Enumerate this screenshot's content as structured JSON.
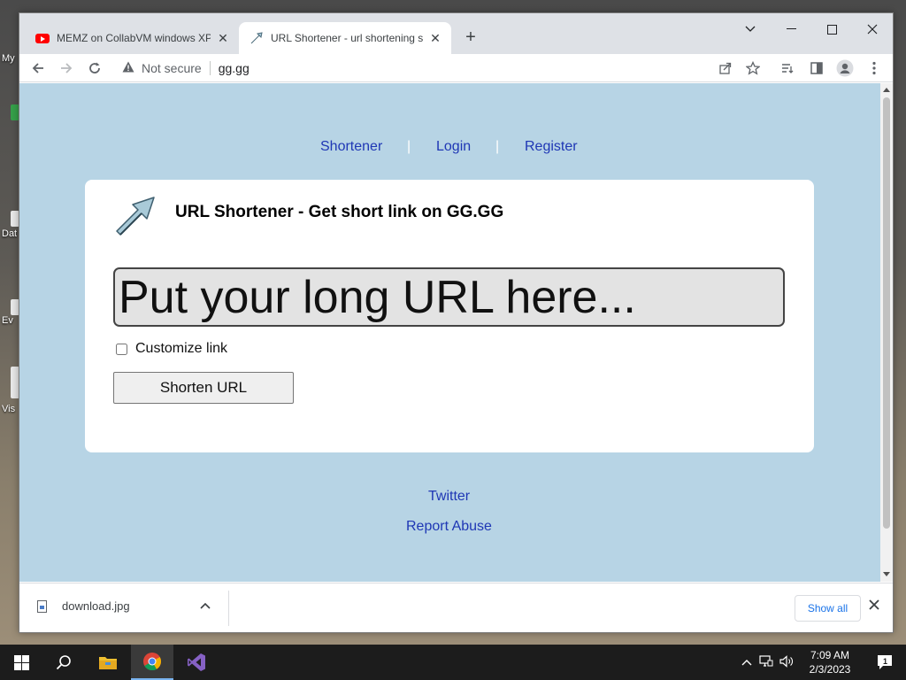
{
  "desktop": {
    "labels": [
      "My",
      "Dat",
      "Ev",
      "Vis"
    ]
  },
  "browser": {
    "tabs": [
      {
        "title": "MEMZ on CollabVM windows XP",
        "favicon": "youtube-icon",
        "active": false
      },
      {
        "title": "URL Shortener - url shortening se",
        "favicon": "arrow-icon",
        "active": true
      }
    ],
    "address": {
      "security": "Not secure",
      "url": "gg.gg"
    }
  },
  "page": {
    "nav": [
      "Shortener",
      "Login",
      "Register"
    ],
    "nav_separator": "|",
    "heading": "URL Shortener - Get short link on GG.GG",
    "input_placeholder": "Put your long URL here...",
    "customize_label": "Customize link",
    "shorten_button": "Shorten URL",
    "footer_links": [
      "Twitter",
      "Report Abuse"
    ]
  },
  "downloads": {
    "file_name": "download.jpg",
    "show_all": "Show all"
  },
  "taskbar": {
    "time": "7:09 AM",
    "date": "2/3/2023",
    "notification_count": "1"
  },
  "colors": {
    "page_background": "#b7d4e5",
    "link": "#1f37b5",
    "accent": "#1a73e8"
  }
}
